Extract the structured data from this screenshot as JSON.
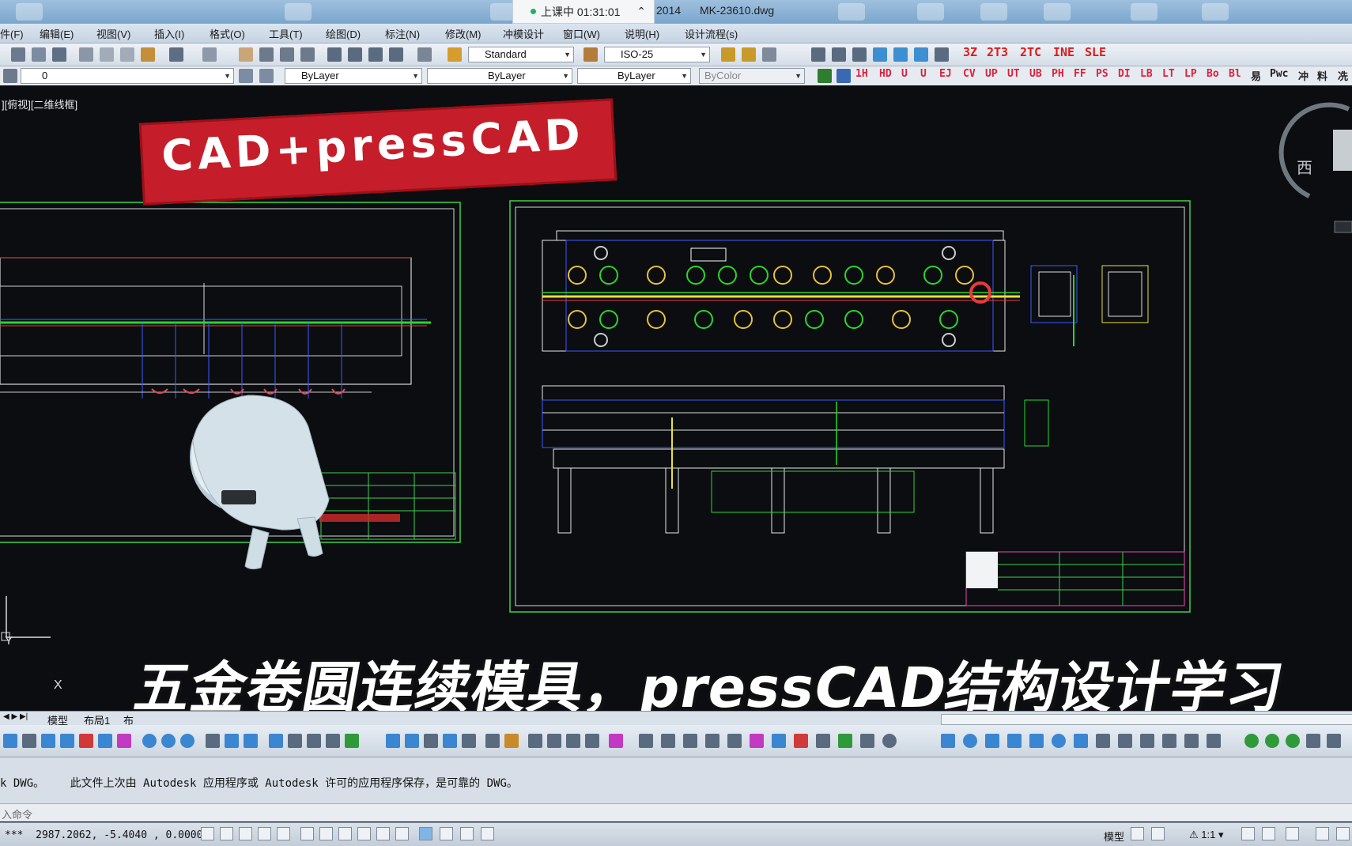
{
  "titlebar": {
    "timer_label": "上课中 01:31:01",
    "version_fragment": "2014",
    "filename": "MK-23610.dwg"
  },
  "menu": [
    "件(F)",
    "编辑(E)",
    "视图(V)",
    "插入(I)",
    "格式(O)",
    "工具(T)",
    "绘图(D)",
    "标注(N)",
    "修改(M)",
    "冲模设计",
    "窗口(W)",
    "说明(H)",
    "设计流程(s)"
  ],
  "toolbar1": {
    "text_style": "Standard",
    "dim_style": "ISO-25",
    "red_commands": [
      "3Z",
      "2T3",
      "2TC",
      "INE",
      "SLE"
    ]
  },
  "toolbar2": {
    "layer": "0",
    "color": "ByLayer",
    "linetype": "ByLayer",
    "lineweight": "ByLayer",
    "plotstyle": "ByColor",
    "red_commands": [
      "1H",
      "HD",
      "U",
      "U",
      "EJ",
      "CV",
      "UP",
      "UT",
      "UB",
      "PH",
      "FF",
      "PS",
      "DI",
      "LB",
      "LT",
      "LP",
      "Bo",
      "Bl",
      "易",
      "Pwc",
      "冲",
      "料",
      "冼"
    ]
  },
  "viewport_label": "][俯视][二维线框]",
  "overlay": {
    "brand": "CAD+pressCAD",
    "subtitle": "五金卷圆连续模具，pressCAD结构设计学习"
  },
  "compass": {
    "west": "西"
  },
  "ucs": {
    "y": "Y",
    "x": "X"
  },
  "tabs": [
    "模型",
    "布局1",
    "布"
  ],
  "command": {
    "history_prefix": "k DWG。",
    "history": "此文件上次由 Autodesk 应用程序或 Autodesk 许可的应用程序保存，是可靠的 DWG。",
    "prompt": "入命令"
  },
  "status": {
    "coords": "2987.2062, -5.4040 , 0.0000",
    "model_label": "模型",
    "scale": "1:1"
  },
  "colors": {
    "banner_red": "#c51e2a",
    "cad_bg": "#0b0d10",
    "frame_green": "#3fd24a"
  }
}
